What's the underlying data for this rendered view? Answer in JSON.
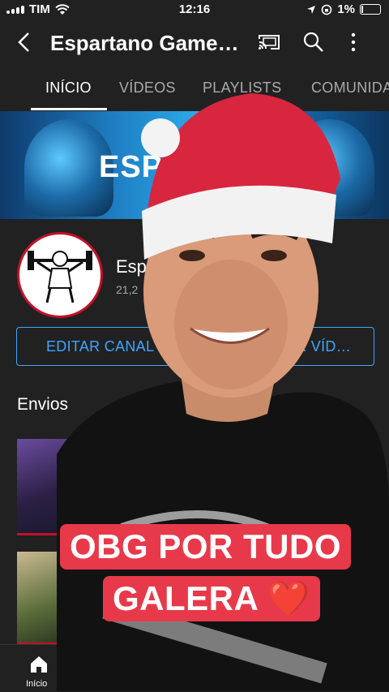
{
  "status_bar": {
    "carrier": "TIM",
    "time": "12:16",
    "battery": "1%"
  },
  "app_bar": {
    "title": "Espartano Game…",
    "back_icon": "chevron-left-icon",
    "cast_icon": "cast-icon",
    "search_icon": "search-icon",
    "more_icon": "more-vertical-icon"
  },
  "tabs": [
    {
      "label": "INÍCIO",
      "active": true
    },
    {
      "label": "VÍDEOS",
      "active": false
    },
    {
      "label": "PLAYLISTS",
      "active": false
    },
    {
      "label": "COMUNIDA",
      "active": false
    }
  ],
  "banner": {
    "text": "ESP"
  },
  "channel": {
    "name": "Esp",
    "subs": "21,2"
  },
  "buttons": {
    "edit": "EDITAR CANAL",
    "upload": "R VÍD…"
  },
  "section": {
    "title": "Envios"
  },
  "bottom_nav": {
    "home_label": "Início"
  },
  "caption": {
    "line1": "OBG POR TUDO",
    "line2": "GALERA ❤️"
  },
  "colors": {
    "background": "#212121",
    "accent_blue": "#3ea6ff",
    "caption_red": "#e8394a",
    "hat_red": "#d7263d"
  }
}
